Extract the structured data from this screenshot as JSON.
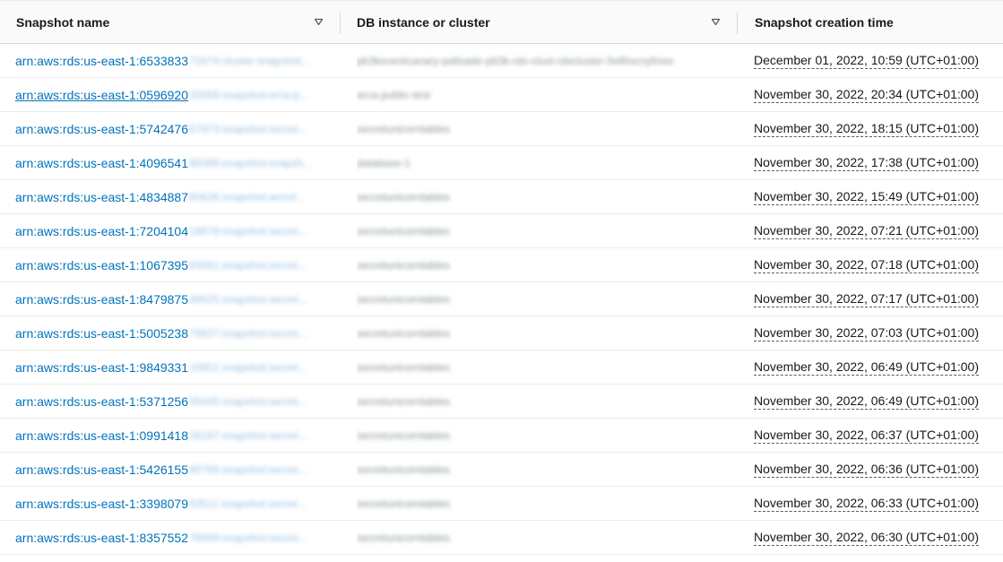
{
  "table": {
    "columns": [
      {
        "label": "Snapshot name",
        "sortable": true
      },
      {
        "label": "DB instance or cluster",
        "sortable": true
      },
      {
        "label": "Snapshot creation time",
        "sortable": false
      }
    ],
    "rows": [
      {
        "name": "arn:aws:rds:us-east-1:6533833",
        "name_blurred": "71674:cluster-snapshot...",
        "db": "pb3keventcanary-palisade-pb3k-rds-clust-rdscluster-5e6hxcryfmss",
        "time": "December 01, 2022, 10:59 (UTC+01:00)"
      },
      {
        "name": "arn:aws:rds:us-east-1:0596920",
        "name_blurred": "20058:snapshot:erca-p...",
        "db": "erca-public-test",
        "time": "November 30, 2022, 20:34 (UTC+01:00)"
      },
      {
        "name": "arn:aws:rds:us-east-1:5742476",
        "name_blurred": "67973:snapshot:secret...",
        "db": "secretunicorntables",
        "time": "November 30, 2022, 18:15 (UTC+01:00)"
      },
      {
        "name": "arn:aws:rds:us-east-1:4096541",
        "name_blurred": "85086:snapshot:snapsh...",
        "db": "database-1",
        "time": "November 30, 2022, 17:38 (UTC+01:00)"
      },
      {
        "name": "arn:aws:rds:us-east-1:4834887",
        "name_blurred": "80626:snapshot:wcnvf...",
        "db": "secretunicorntables",
        "time": "November 30, 2022, 15:49 (UTC+01:00)"
      },
      {
        "name": "arn:aws:rds:us-east-1:7204104",
        "name_blurred": "18679:snapshot:secret...",
        "db": "secretunicorntables",
        "time": "November 30, 2022, 07:21 (UTC+01:00)"
      },
      {
        "name": "arn:aws:rds:us-east-1:1067395",
        "name_blurred": "83061:snapshot:secret...",
        "db": "secretunicorntables",
        "time": "November 30, 2022, 07:18 (UTC+01:00)"
      },
      {
        "name": "arn:aws:rds:us-east-1:8479875",
        "name_blurred": "49025:snapshot:secret...",
        "db": "secretunicorntables",
        "time": "November 30, 2022, 07:17 (UTC+01:00)"
      },
      {
        "name": "arn:aws:rds:us-east-1:5005238",
        "name_blurred": "79837:snapshot:secret...",
        "db": "secretunicorntables",
        "time": "November 30, 2022, 07:03 (UTC+01:00)"
      },
      {
        "name": "arn:aws:rds:us-east-1:9849331",
        "name_blurred": "10651:snapshot:secret...",
        "db": "secretunicorntables",
        "time": "November 30, 2022, 06:49 (UTC+01:00)"
      },
      {
        "name": "arn:aws:rds:us-east-1:5371256",
        "name_blurred": "05445:snapshot:secret...",
        "db": "secretunicorntables",
        "time": "November 30, 2022, 06:49 (UTC+01:00)"
      },
      {
        "name": "arn:aws:rds:us-east-1:0991418",
        "name_blurred": "28167:snapshot:secret...",
        "db": "secretunicorntables",
        "time": "November 30, 2022, 06:37 (UTC+01:00)"
      },
      {
        "name": "arn:aws:rds:us-east-1:5426155",
        "name_blurred": "80766:snapshot:secret...",
        "db": "secretunicorntables",
        "time": "November 30, 2022, 06:36 (UTC+01:00)"
      },
      {
        "name": "arn:aws:rds:us-east-1:3398079",
        "name_blurred": "93511:snapshot:secret...",
        "db": "secretunicorntables",
        "time": "November 30, 2022, 06:33 (UTC+01:00)"
      },
      {
        "name": "arn:aws:rds:us-east-1:8357552",
        "name_blurred": "76909:snapshot:secret...",
        "db": "secretunicorntables",
        "time": "November 30, 2022, 06:30 (UTC+01:00)"
      }
    ],
    "hovered_row_index": 1
  },
  "colors": {
    "link": "#0073bb",
    "text": "#16191f",
    "border": "#eaeded"
  },
  "icons": {
    "sort": "caret-down-outline-icon"
  }
}
